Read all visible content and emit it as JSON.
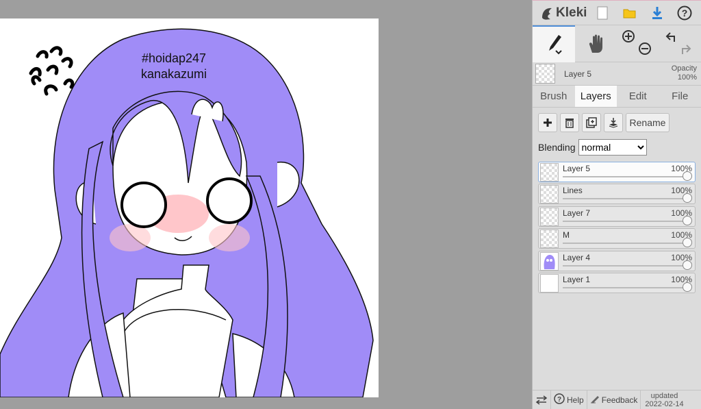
{
  "canvas": {
    "artist_tag_line1": "#hoidap247",
    "artist_tag_line2": "kanakazumi"
  },
  "app": {
    "name": "Kleki",
    "accent": "#4f8ed8"
  },
  "toolbar": {
    "icons": [
      "new-image-icon",
      "open-folder-icon",
      "download-icon",
      "help-icon"
    ]
  },
  "current_layer": {
    "name": "Layer 5",
    "opacity_label": "Opacity",
    "opacity_value": "100%"
  },
  "tabs": [
    {
      "label": "Brush",
      "active": false
    },
    {
      "label": "Layers",
      "active": true
    },
    {
      "label": "Edit",
      "active": false
    },
    {
      "label": "File",
      "active": false
    }
  ],
  "layers_panel": {
    "rename_label": "Rename",
    "blending_label": "Blending",
    "blending_value": "normal",
    "layers": [
      {
        "name": "Layer 5",
        "opacity": "100%",
        "active": true
      },
      {
        "name": "Lines",
        "opacity": "100%",
        "active": false
      },
      {
        "name": "Layer 7",
        "opacity": "100%",
        "active": false
      },
      {
        "name": "M",
        "opacity": "100%",
        "active": false
      },
      {
        "name": "Layer 4",
        "opacity": "100%",
        "active": false
      },
      {
        "name": "Layer 1",
        "opacity": "100%",
        "active": false
      }
    ]
  },
  "bottom": {
    "help_label": "Help",
    "feedback_label": "Feedback",
    "updated_label": "updated",
    "updated_date": "2022-02-14"
  },
  "colors": {
    "hair": "#a08cf7",
    "blush": "#ff9aa0",
    "sidebar_bg": "#dcdcdc"
  }
}
